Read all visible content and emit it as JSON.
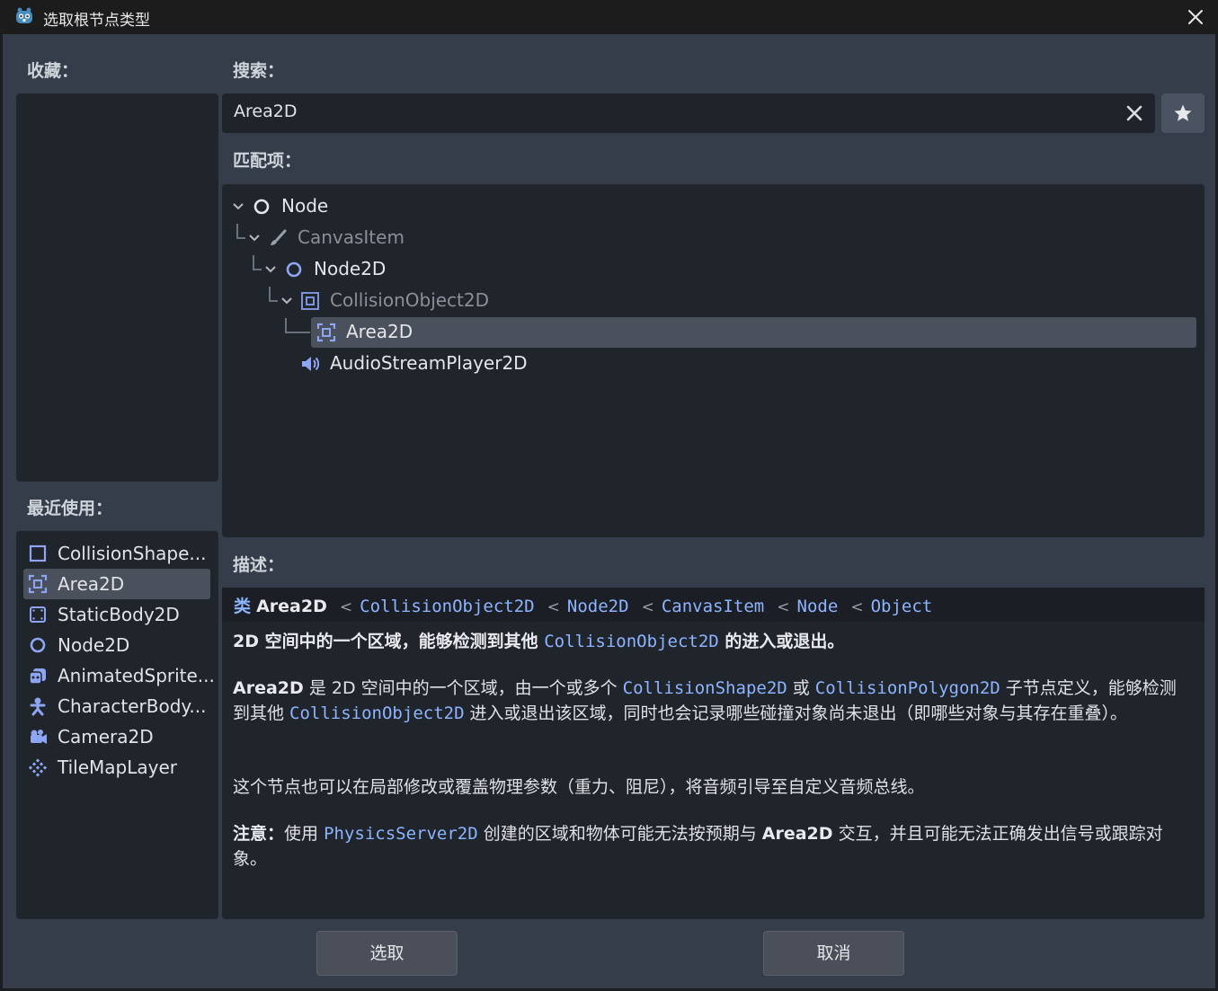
{
  "window": {
    "title": "选取根节点类型",
    "icon": "godot-icon",
    "close_icon": "close-icon"
  },
  "favorites": {
    "label": "收藏："
  },
  "recent": {
    "label": "最近使用：",
    "items": [
      {
        "label": "CollisionShape...",
        "icon": "collision-shape-icon",
        "selected": false
      },
      {
        "label": "Area2D",
        "icon": "area2d-icon",
        "selected": true
      },
      {
        "label": "StaticBody2D",
        "icon": "static-body-icon",
        "selected": false
      },
      {
        "label": "Node2D",
        "icon": "node2d-icon",
        "selected": false
      },
      {
        "label": "AnimatedSprite...",
        "icon": "animated-sprite-icon",
        "selected": false
      },
      {
        "label": "CharacterBody...",
        "icon": "character-body-icon",
        "selected": false
      },
      {
        "label": "Camera2D",
        "icon": "camera-icon",
        "selected": false
      },
      {
        "label": "TileMapLayer",
        "icon": "tilemap-icon",
        "selected": false
      }
    ]
  },
  "search": {
    "label": "搜索：",
    "value": "Area2D",
    "clear_icon": "clear-icon",
    "favorite_icon": "star-icon"
  },
  "matches": {
    "label": "匹配项：",
    "tree": [
      {
        "label": "Node",
        "icon": "node-icon",
        "expanded": true,
        "dim": false
      },
      {
        "label": "CanvasItem",
        "icon": "brush-icon",
        "expanded": true,
        "dim": true
      },
      {
        "label": "Node2D",
        "icon": "node2d-icon",
        "expanded": true,
        "dim": false
      },
      {
        "label": "CollisionObject2D",
        "icon": "collision-object-icon",
        "expanded": true,
        "dim": true
      },
      {
        "label": "Area2D",
        "icon": "area2d-icon",
        "selected": true,
        "dim": false
      },
      {
        "label": "AudioStreamPlayer2D",
        "icon": "speaker-icon",
        "dim": false
      }
    ]
  },
  "description": {
    "label": "描述：",
    "class_kw": "类",
    "class_name": "Area2D",
    "inherits": [
      "CollisionObject2D",
      "Node2D",
      "CanvasItem",
      "Node",
      "Object"
    ],
    "inherit_sep": "<",
    "summary_a": "2D 空间中的一个区域，能够检测到其他 ",
    "summary_link": "CollisionObject2D",
    "summary_b": " 的进入或退出。",
    "p1_bold": "Area2D",
    "p1_a": " 是 2D 空间中的一个区域，由一个或多个 ",
    "p1_link1": "CollisionShape2D",
    "p1_b": " 或 ",
    "p1_link2": "CollisionPolygon2D",
    "p1_c": " 子节点定义，能够检测到其他 ",
    "p1_link3": "CollisionObject2D",
    "p1_d": " 进入或退出该区域，同时也会记录哪些碰撞对象尚未退出（即哪些对象与其存在重叠）。",
    "p2": "这个节点也可以在局部修改或覆盖物理参数（重力、阻尼），将音频引导至自定义音频总线。",
    "p3_bold": "注意：",
    "p3_a": "使用 ",
    "p3_link": "PhysicsServer2D",
    "p3_b": " 创建的区域和物体可能无法按预期与 ",
    "p3_bold2": "Area2D",
    "p3_c": " 交互，并且可能无法正确发出信号或跟踪对象。"
  },
  "buttons": {
    "select": "选取",
    "cancel": "取消"
  },
  "colors": {
    "accent": "#8db4ff",
    "icon_blue": "#8da5f3",
    "selection": "#4a505c"
  }
}
